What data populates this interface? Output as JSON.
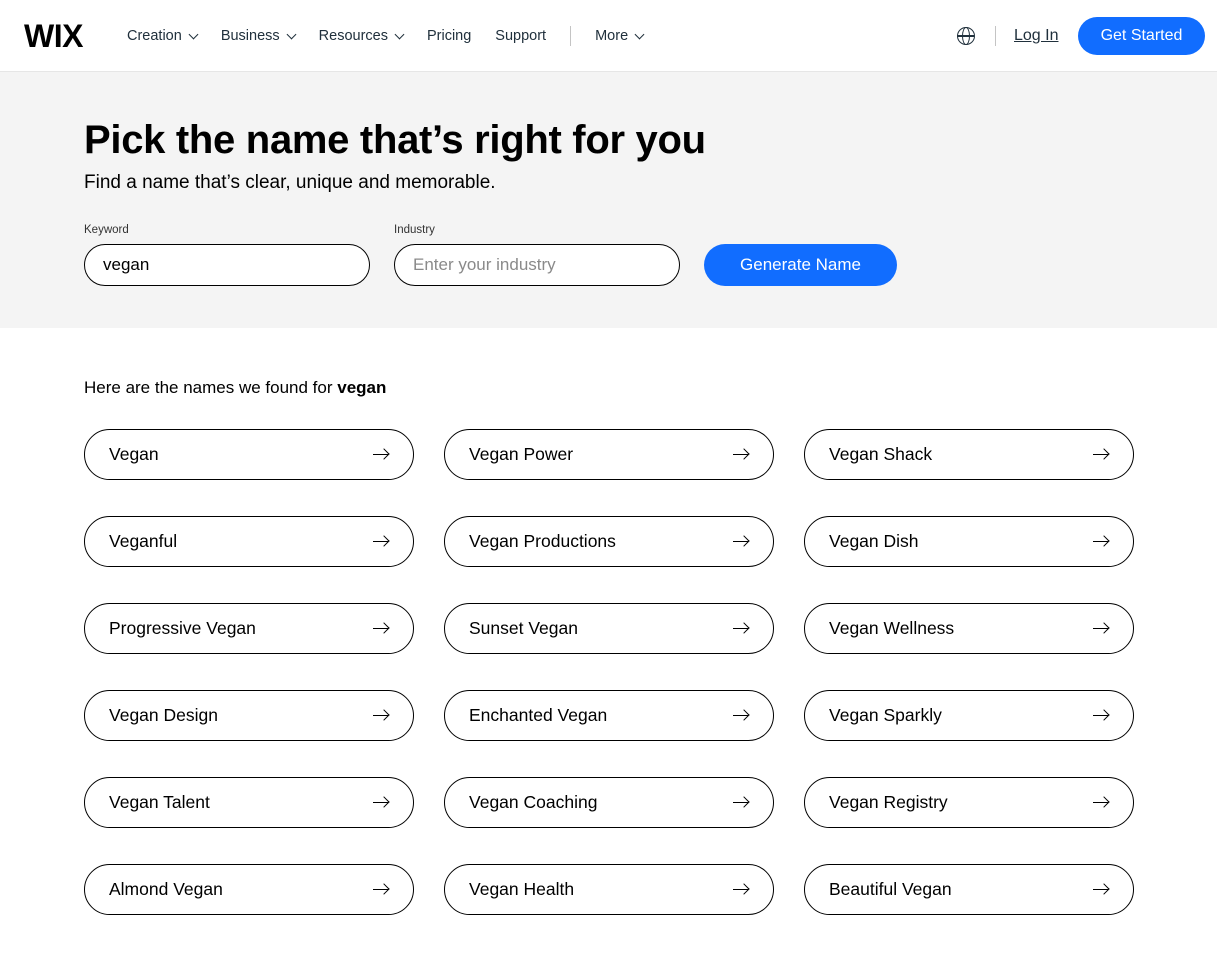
{
  "header": {
    "logo": "WIX",
    "nav": [
      {
        "label": "Creation",
        "has_dropdown": true
      },
      {
        "label": "Business",
        "has_dropdown": true
      },
      {
        "label": "Resources",
        "has_dropdown": true
      },
      {
        "label": "Pricing",
        "has_dropdown": false
      },
      {
        "label": "Support",
        "has_dropdown": false
      },
      {
        "label": "More",
        "has_dropdown": true
      }
    ],
    "language_icon": "globe-icon",
    "login_label": "Log In",
    "cta_label": "Get Started"
  },
  "hero": {
    "title": "Pick the name that’s right for you",
    "subtitle": "Find a name that’s clear, unique and memorable.",
    "keyword_label": "Keyword",
    "keyword_value": "vegan",
    "industry_label": "Industry",
    "industry_value": "",
    "industry_placeholder": "Enter your industry",
    "generate_label": "Generate Name"
  },
  "results": {
    "caption_prefix": "Here are the names we found for ",
    "caption_keyword": "vegan",
    "names": [
      "Vegan",
      "Vegan Power",
      "Vegan Shack",
      "Veganful",
      "Vegan Productions",
      "Vegan Dish",
      "Progressive Vegan",
      "Sunset Vegan",
      "Vegan Wellness",
      "Vegan Design",
      "Enchanted Vegan",
      "Vegan Sparkly",
      "Vegan Talent",
      "Vegan Coaching",
      "Vegan Registry",
      "Almond Vegan",
      "Vegan Health",
      "Beautiful Vegan"
    ],
    "item_icon": "arrow-right-icon"
  },
  "colors": {
    "accent": "#116dff",
    "hero_background": "#f4f4f4",
    "text": "#000000",
    "nav_text": "#20303c"
  }
}
